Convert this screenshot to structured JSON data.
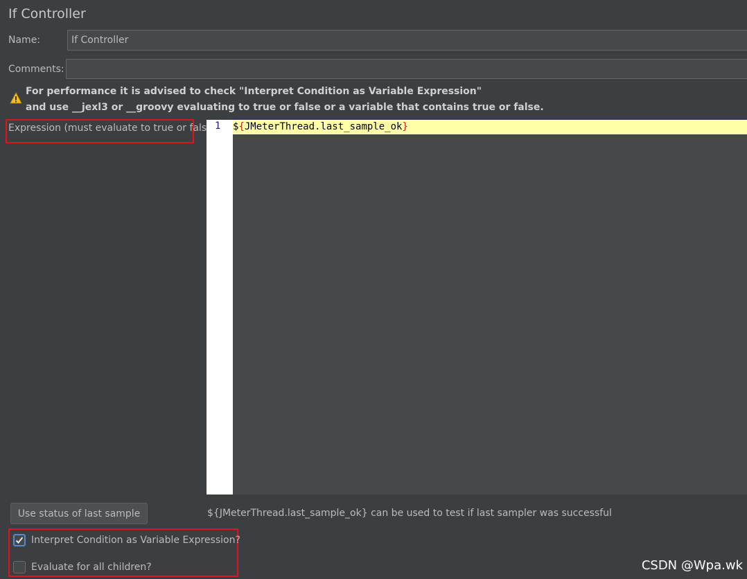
{
  "panel": {
    "title": "If Controller"
  },
  "name": {
    "label": "Name:",
    "value": "If Controller"
  },
  "comments": {
    "label": "Comments:",
    "value": ""
  },
  "warning": {
    "icon": "warning-icon",
    "line1": "For performance it is advised to check \"Interpret Condition as Variable Expression\"",
    "line2": "and use __jexl3 or __groovy evaluating to true or false or a variable that contains true or false."
  },
  "expression": {
    "label": "Expression (must evaluate to true or false)",
    "line_number": "1",
    "code_prefix": "$",
    "code_open_brace": "{",
    "code_body": "JMeterThread.last_sample_ok",
    "code_close_brace": "}"
  },
  "last_sample": {
    "button_label": "Use status of last sample",
    "hint": "${JMeterThread.last_sample_ok} can be used to test if last sampler was successful"
  },
  "options": {
    "interpret_label": "Interpret Condition as Variable Expression?",
    "interpret_checked": true,
    "evaluate_all_label": "Evaluate for all children?",
    "evaluate_all_checked": false
  },
  "watermark": "CSDN @Wpa.wk",
  "colors": {
    "background": "#3c3f41",
    "editor_highlight": "#ffffa8",
    "annotation_red": "#e0141e",
    "warning_yellow": "#f0c020"
  }
}
